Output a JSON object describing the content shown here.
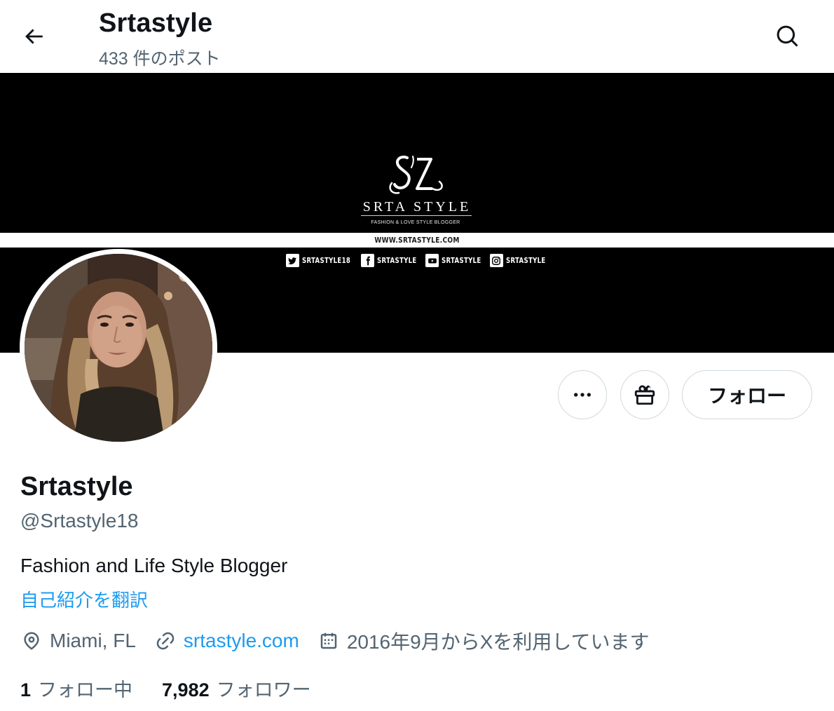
{
  "header": {
    "title": "Srtastyle",
    "post_count": "433 件のポスト",
    "back_icon": "arrow-left-icon",
    "search_icon": "search-icon"
  },
  "banner": {
    "brand": "SRTA STYLE",
    "tagline": "FASHION & LOVE STYLE BLOGGER",
    "url": "WWW.SRTASTYLE.COM",
    "socials": [
      {
        "icon": "twitter-icon",
        "label": "SRTASTYLE18"
      },
      {
        "icon": "facebook-icon",
        "label": "SRTASTYLE"
      },
      {
        "icon": "youtube-icon",
        "label": "SRTASTYLE"
      },
      {
        "icon": "instagram-icon",
        "label": "SRTASTYLE"
      }
    ]
  },
  "actions": {
    "more_icon": "more-horizontal-icon",
    "gift_icon": "gift-icon",
    "follow_label": "フォロー"
  },
  "profile": {
    "display_name": "Srtastyle",
    "handle": "@Srtastyle18",
    "bio": "Fashion and Life Style Blogger",
    "translate_label": "自己紹介を翻訳",
    "location": "Miami, FL",
    "website": "srtastyle.com",
    "joined": "2016年9月からXを利用しています"
  },
  "stats": {
    "following_count": "1",
    "following_label": "フォロー中",
    "followers_count": "7,982",
    "followers_label": "フォロワー"
  },
  "colors": {
    "text_primary": "#0f1419",
    "text_secondary": "#536471",
    "link": "#1d9bf0",
    "border": "#cfd9de",
    "banner_bg": "#000000"
  }
}
